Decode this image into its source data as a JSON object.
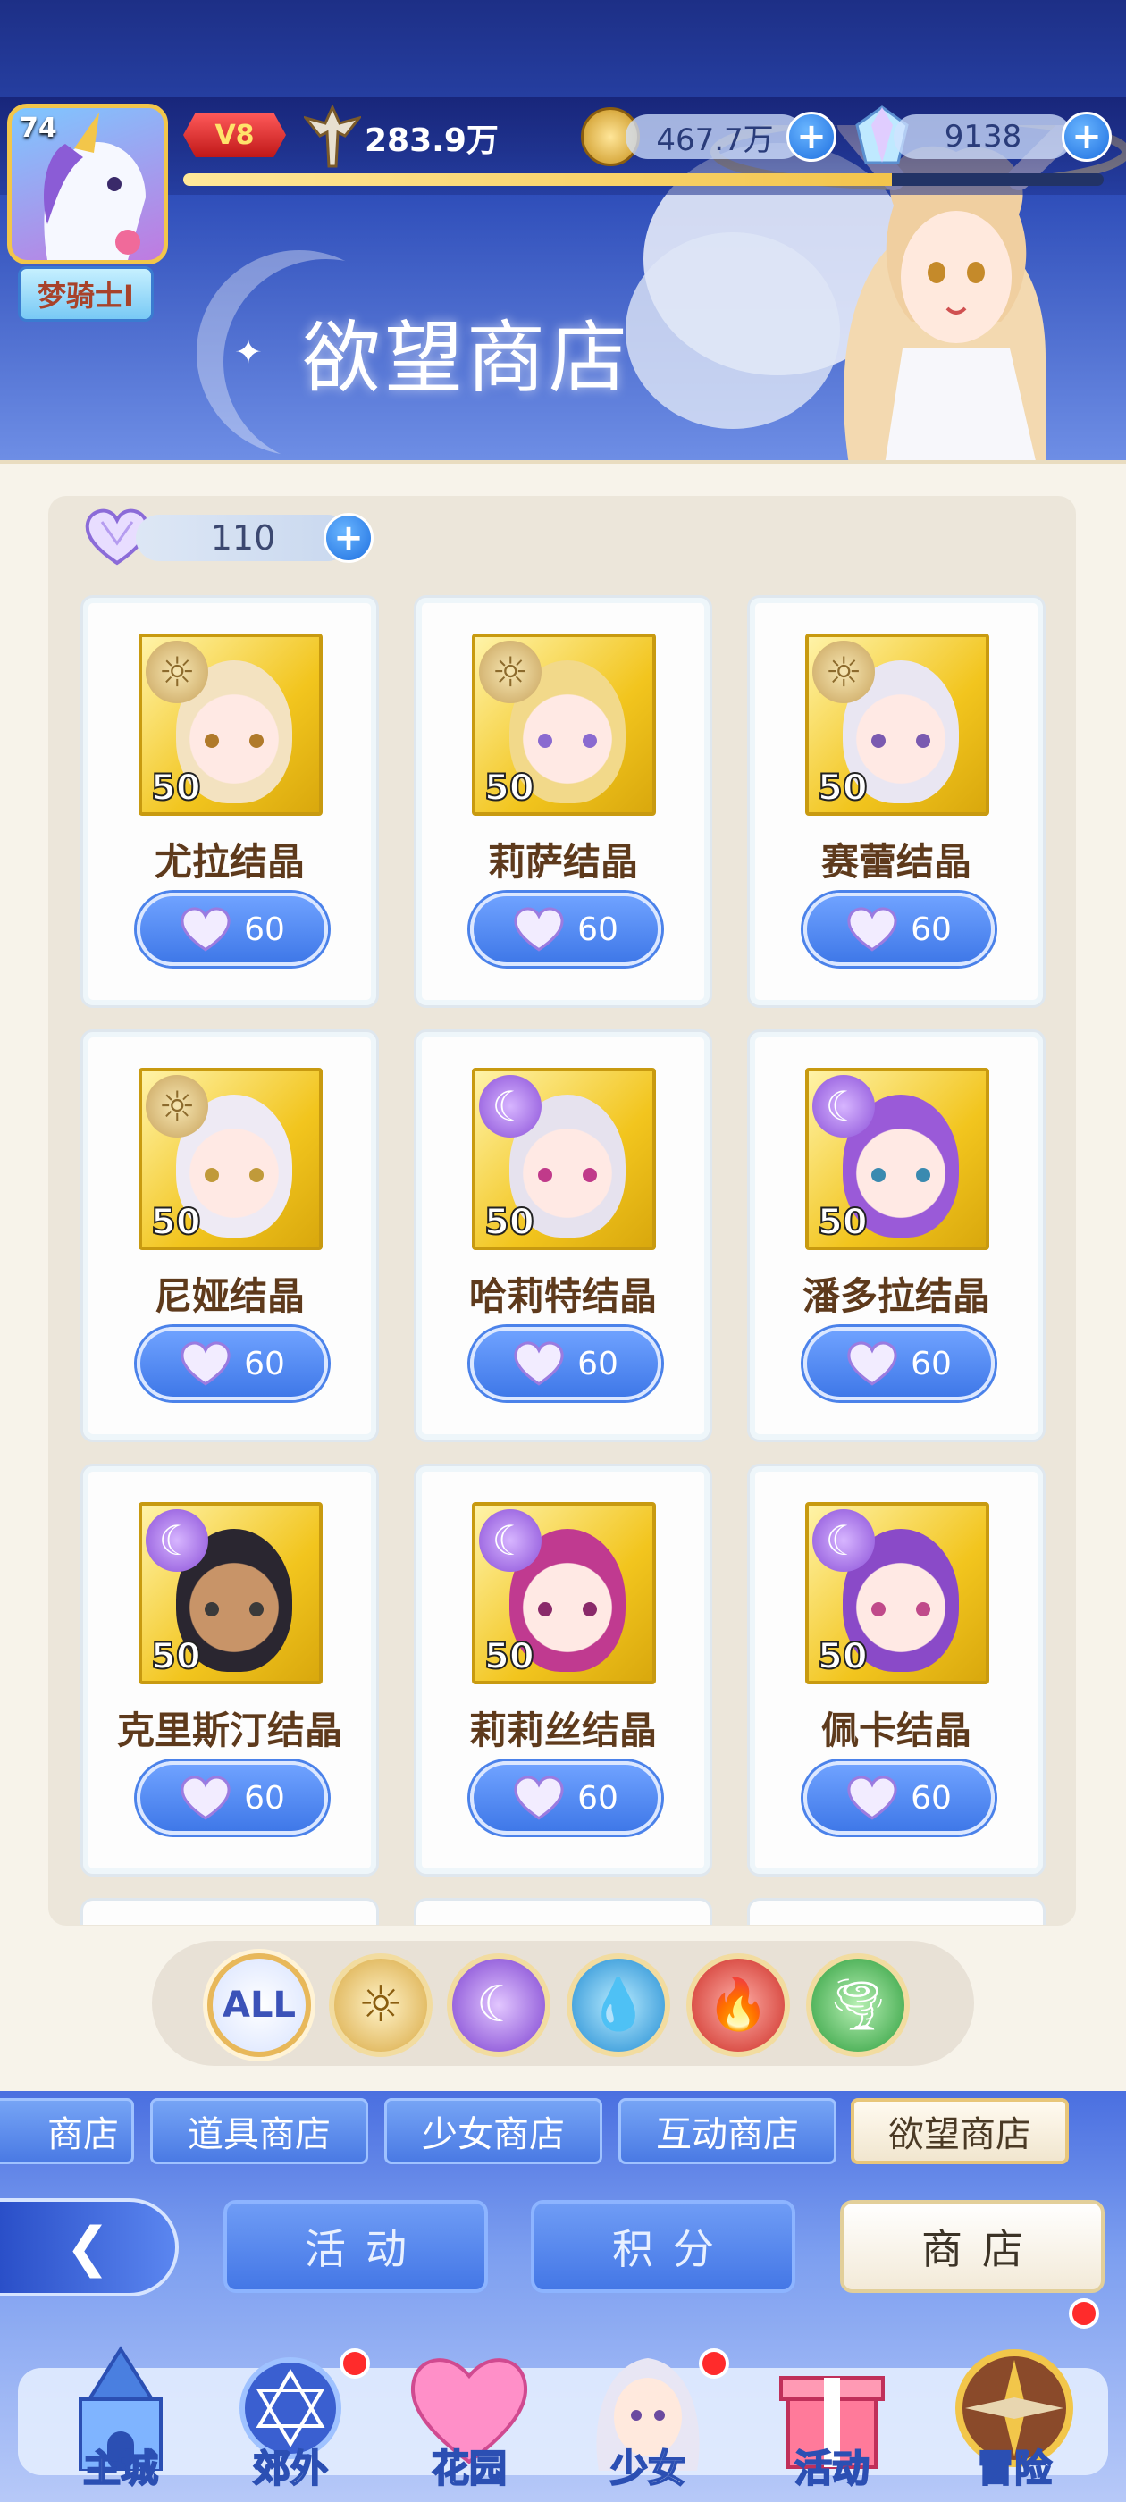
{
  "player": {
    "level": "74",
    "name": "梦骑士I",
    "vip": "V8",
    "power": "283.9万",
    "exp_progress": 0.77
  },
  "resources": {
    "gold": "467.7万",
    "gems": "9138"
  },
  "shop": {
    "title": "欲望商店",
    "currency_amount": "110"
  },
  "items": [
    {
      "name": "尤拉结晶",
      "qty": "50",
      "price": "60",
      "element": "light-element-icon"
    },
    {
      "name": "莉萨结晶",
      "qty": "50",
      "price": "60",
      "element": "light-element-icon"
    },
    {
      "name": "赛蕾结晶",
      "qty": "50",
      "price": "60",
      "element": "light-element-icon"
    },
    {
      "name": "尼娅结晶",
      "qty": "50",
      "price": "60",
      "element": "light-element-icon"
    },
    {
      "name": "哈莉特结晶",
      "qty": "50",
      "price": "60",
      "element": "dark-element-icon"
    },
    {
      "name": "潘多拉结晶",
      "qty": "50",
      "price": "60",
      "element": "dark-element-icon"
    },
    {
      "name": "克里斯汀结晶",
      "qty": "50",
      "price": "60",
      "element": "dark-element-icon"
    },
    {
      "name": "莉莉丝结晶",
      "qty": "50",
      "price": "60",
      "element": "dark-element-icon"
    },
    {
      "name": "佩卡结晶",
      "qty": "50",
      "price": "60",
      "element": "dark-element-icon"
    }
  ],
  "filters": {
    "all_label": "ALL"
  },
  "shop_tabs": [
    "商店",
    "道具商店",
    "少女商店",
    "互动商店",
    "欲望商店"
  ],
  "mid_tabs": [
    "活动",
    "积分",
    "商店"
  ],
  "nav": [
    "主城",
    "郊外",
    "花园",
    "少女",
    "活动",
    "冒险"
  ],
  "colors": {
    "accent_blue": "#3f78e8",
    "gold": "#f2c51e",
    "badge_red": "#ff2b2b"
  }
}
